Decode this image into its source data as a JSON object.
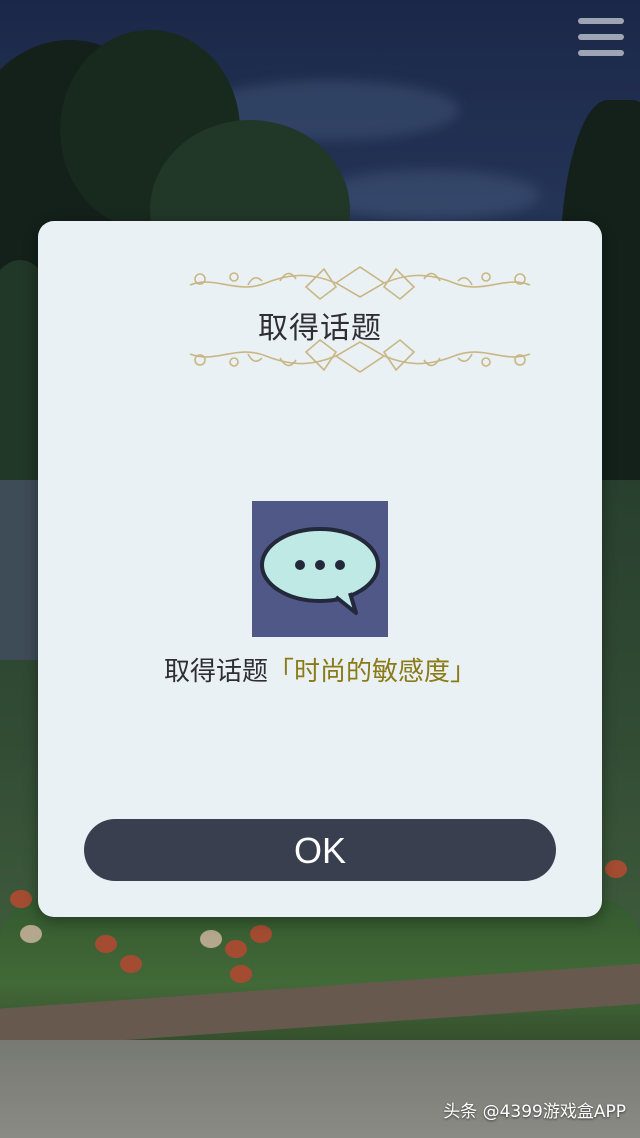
{
  "menu": {
    "icon": "hamburger-menu-icon"
  },
  "dialog": {
    "title": "取得话题",
    "ornament_icon": "vine-ornament-icon",
    "topic_icon": "speech-bubble-icon",
    "message_prefix": "取得话题",
    "topic_name": "「时尚的敏感度」",
    "ok_label": "OK",
    "colors": {
      "panel": "#eaf1f5",
      "topic_name": "#8b7a18",
      "ok_button": "#3a3f4f",
      "icon_bg": "#4f5886",
      "bubble": "#bfe9e4"
    }
  },
  "watermark": "头条 @4399游戏盒APP"
}
